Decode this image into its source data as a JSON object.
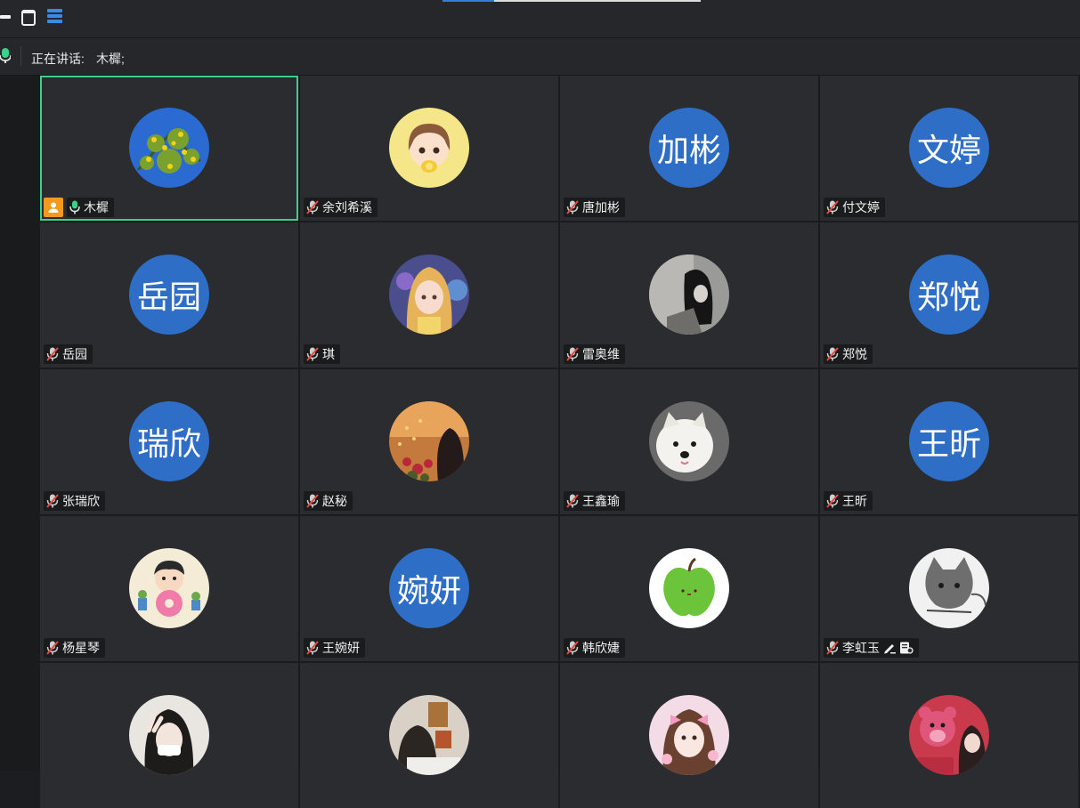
{
  "window": {
    "minimize_icon": "minimize-icon",
    "maximize_icon": "maximize-icon",
    "view_icon": "gallery-view-icon"
  },
  "speaking": {
    "label": "正在讲话:",
    "name": "木樨;"
  },
  "colors": {
    "active_border": "#3bd18a",
    "avatar_blue": "#2e6ec7",
    "host_badge": "#f19a1b",
    "muted_icon": "#e5483f"
  },
  "participants": [
    {
      "name": "木樨",
      "avatar_text": "",
      "avatar": "photo-yellow-flowers",
      "muted": false,
      "host": true,
      "active": true
    },
    {
      "name": "余刘希溪",
      "avatar_text": "",
      "avatar": "cartoon-girl",
      "muted": true
    },
    {
      "name": "唐加彬",
      "avatar_text": "加彬",
      "muted": true
    },
    {
      "name": "付文婷",
      "avatar_text": "文婷",
      "muted": true
    },
    {
      "name": "岳园",
      "avatar_text": "岳园",
      "muted": true
    },
    {
      "name": "琪",
      "avatar_text": "",
      "avatar": "anime-girl",
      "muted": true
    },
    {
      "name": "雷奥维",
      "avatar_text": "",
      "avatar": "dark-hair-figure",
      "muted": true
    },
    {
      "name": "郑悦",
      "avatar_text": "郑悦",
      "muted": true
    },
    {
      "name": "张瑞欣",
      "avatar_text": "瑞欣",
      "muted": true
    },
    {
      "name": "赵秘",
      "avatar_text": "",
      "avatar": "sunset-flowers",
      "muted": true
    },
    {
      "name": "王鑫瑜",
      "avatar_text": "",
      "avatar": "white-dog",
      "muted": true
    },
    {
      "name": "王昕",
      "avatar_text": "王昕",
      "muted": true
    },
    {
      "name": "杨星琴",
      "avatar_text": "",
      "avatar": "cartoon-boy-donut",
      "muted": true
    },
    {
      "name": "王婉妍",
      "avatar_text": "婉妍",
      "muted": true
    },
    {
      "name": "韩欣婕",
      "avatar_text": "",
      "avatar": "green-apple",
      "muted": true
    },
    {
      "name": "李虹玉",
      "avatar_text": "",
      "avatar": "gray-cat-sketch",
      "muted": true,
      "extra_icons": [
        "pen-icon",
        "doc-settings-icon"
      ]
    },
    {
      "name": "",
      "avatar_text": "",
      "avatar": "girl-peace-sign",
      "muted": true
    },
    {
      "name": "",
      "avatar_text": "",
      "avatar": "girl-poster-wall",
      "muted": true
    },
    {
      "name": "",
      "avatar_text": "",
      "avatar": "girl-pink-bow",
      "muted": true
    },
    {
      "name": "",
      "avatar_text": "",
      "avatar": "lotso-bear-selfie",
      "muted": true
    }
  ]
}
